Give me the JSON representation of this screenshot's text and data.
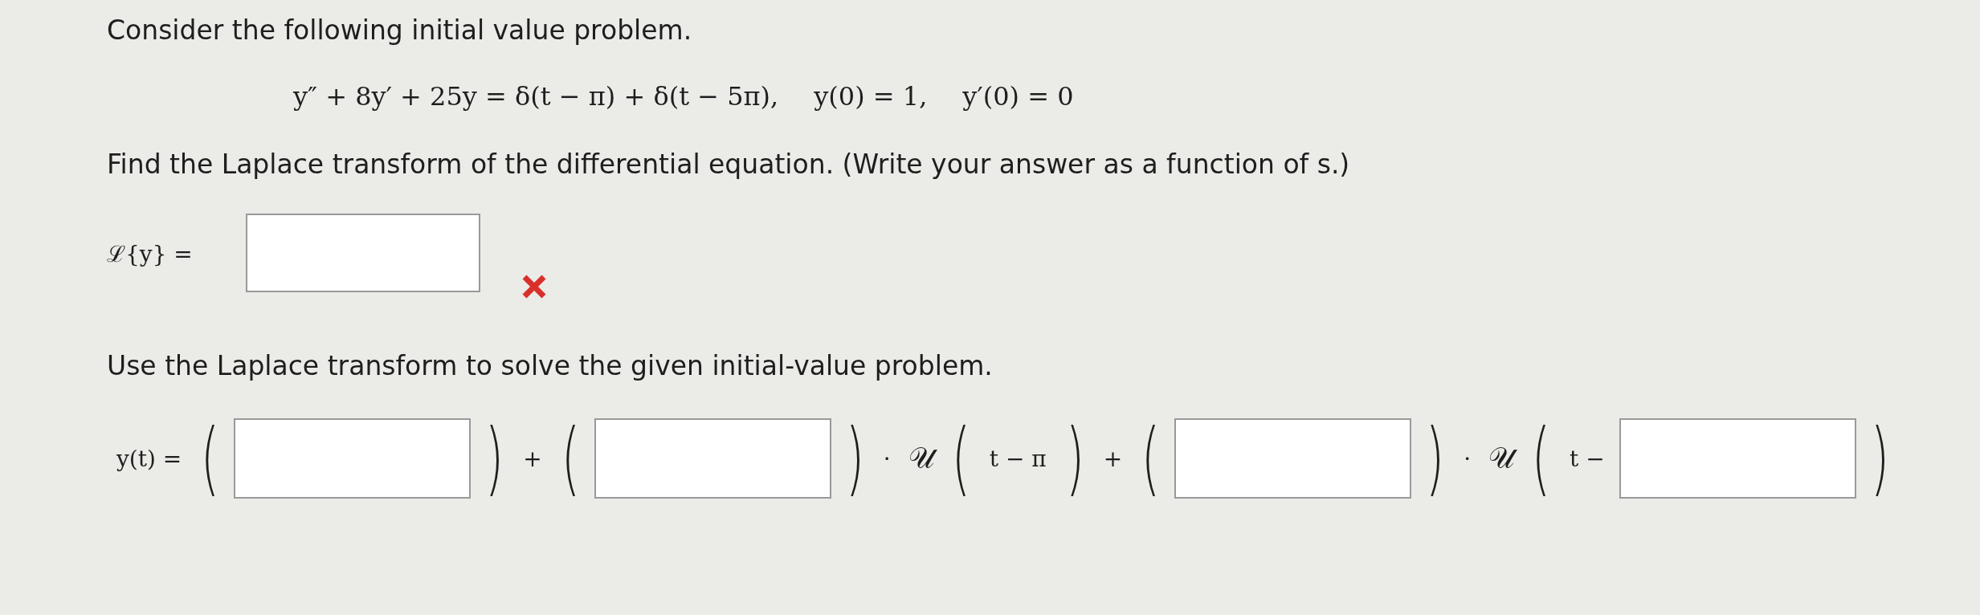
{
  "intro": "Consider the following initial value problem.",
  "equation": [
    "y″ + 8y′ + 25y = δ(t − π) + δ(t − 5π),",
    "y(0) = 1,",
    "y′(0) = 0"
  ],
  "question_1": "Find the Laplace transform of the differential equation. (Write your answer as a function of s.)",
  "transform": {
    "label": "ℒ{y} =",
    "correct": false
  },
  "question_2": "Use the Laplace transform to solve the given initial-value problem.",
  "solution": [
    {
      "kind": "text",
      "text": "y(t) ="
    },
    {
      "kind": "paren",
      "text": "("
    },
    {
      "kind": "field"
    },
    {
      "kind": "paren",
      "text": ")"
    },
    {
      "kind": "text",
      "text": "+"
    },
    {
      "kind": "paren",
      "text": "("
    },
    {
      "kind": "field"
    },
    {
      "kind": "paren",
      "text": ")"
    },
    {
      "kind": "text",
      "text": "·"
    },
    {
      "kind": "script",
      "text": "𝒰"
    },
    {
      "kind": "paren",
      "text": "("
    },
    {
      "kind": "text",
      "text": "t − π"
    },
    {
      "kind": "paren",
      "text": ")"
    },
    {
      "kind": "text",
      "text": "+"
    },
    {
      "kind": "paren",
      "text": "("
    },
    {
      "kind": "field"
    },
    {
      "kind": "paren",
      "text": ")"
    },
    {
      "kind": "text",
      "text": "·"
    },
    {
      "kind": "script",
      "text": "𝒰"
    },
    {
      "kind": "paren",
      "text": "("
    },
    {
      "kind": "text",
      "text": "t −"
    },
    {
      "kind": "field"
    },
    {
      "kind": "paren",
      "text": ")"
    }
  ]
}
